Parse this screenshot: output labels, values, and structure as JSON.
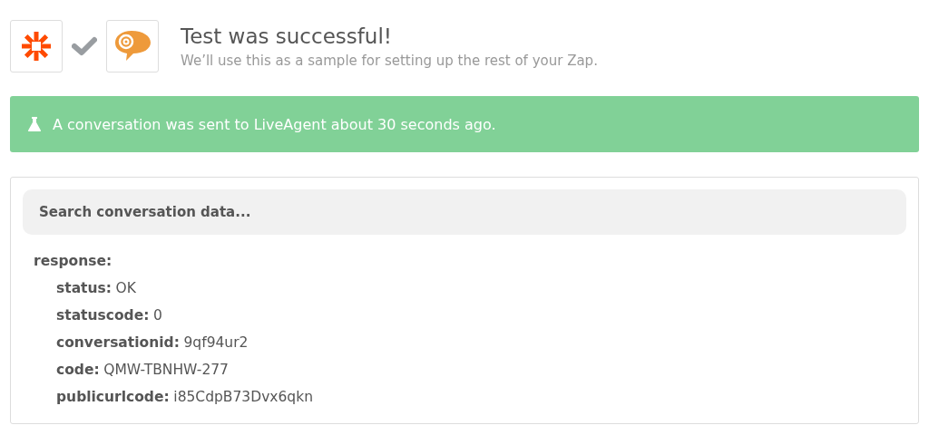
{
  "header": {
    "title": "Test was successful!",
    "subtitle": "We’ll use this as a sample for setting up the rest of your Zap."
  },
  "banner": {
    "message": "A conversation was sent to LiveAgent about 30 seconds ago."
  },
  "search": {
    "placeholder": "Search conversation data..."
  },
  "tree": [
    {
      "key": "response:",
      "children": [
        {
          "key": "status:",
          "value": "OK"
        },
        {
          "key": "statuscode:",
          "value": "0"
        },
        {
          "key": "conversationid:",
          "value": "9qf94ur2"
        },
        {
          "key": "code:",
          "value": "QMW-TBNHW-277"
        },
        {
          "key": "publicurlcode:",
          "value": "i85CdpB73Dvx6qkn"
        }
      ]
    }
  ]
}
